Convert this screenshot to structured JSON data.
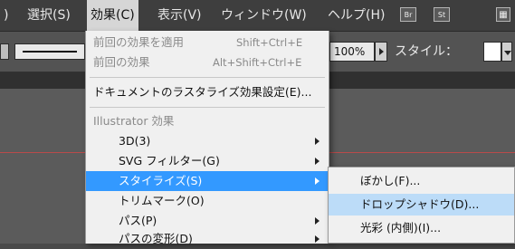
{
  "menubar": {
    "items": [
      {
        "label": ")"
      },
      {
        "label": "選択(S)"
      },
      {
        "label": "効果(C)"
      },
      {
        "label": "表示(V)"
      },
      {
        "label": "ウィンドウ(W)"
      },
      {
        "label": "ヘルプ(H)"
      }
    ],
    "bridge_label": "Br",
    "stock_label": "St"
  },
  "controlbar": {
    "opacity_value": "100%",
    "style_label": "スタイル："
  },
  "effect_menu": {
    "items": [
      {
        "label": "前回の効果を適用",
        "shortcut": "Shift+Ctrl+E",
        "enabled": false
      },
      {
        "label": "前回の効果",
        "shortcut": "Alt+Shift+Ctrl+E",
        "enabled": false
      },
      {
        "label": "ドキュメントのラスタライズ効果設定(E)...",
        "enabled": true
      },
      {
        "label": "Illustrator 効果",
        "enabled": false
      },
      {
        "label": "3D(3)",
        "submenu": true
      },
      {
        "label": "SVG フィルター(G)",
        "submenu": true
      },
      {
        "label": "スタイライズ(S)",
        "submenu": true,
        "highlighted": true
      },
      {
        "label": "トリムマーク(O)",
        "submenu": false
      },
      {
        "label": "パス(P)",
        "submenu": true
      },
      {
        "label": "パスの変形(D)",
        "submenu": true
      }
    ]
  },
  "stylize_submenu": {
    "items": [
      {
        "label": "ぼかし(F)..."
      },
      {
        "label": "ドロップシャドウ(D)...",
        "highlighted": true
      },
      {
        "label": "光彩 (内側)(I)..."
      }
    ]
  },
  "colors": {
    "highlight": "#3399ff",
    "submenu_highlight": "#bcdcf8",
    "menubar_bg": "#3e3e3e"
  }
}
